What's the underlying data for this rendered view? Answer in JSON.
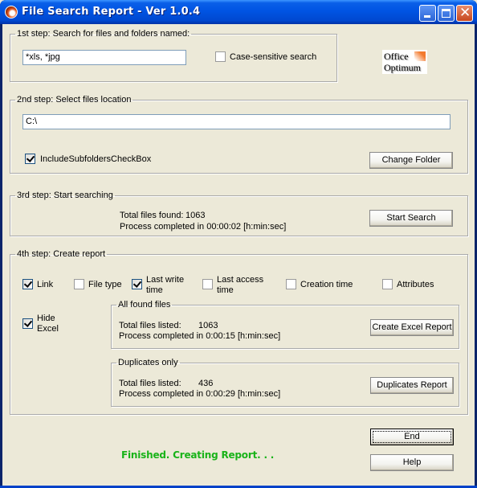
{
  "window": {
    "title": "File Search Report - Ver 1.0.4",
    "icons": {
      "app": "app-icon",
      "minimize": "minimize-icon",
      "maximize": "maximize-icon",
      "close": "close-icon"
    },
    "close_glyph": "✕"
  },
  "logo": {
    "line1": "Office",
    "line2": "Optimum",
    "accent_color": "#F37A2E"
  },
  "step1": {
    "legend": "1st step: Search for files and folders named:",
    "search_value": "*xls, *jpg",
    "case_sensitive_label": "Case-sensitive search",
    "case_sensitive_checked": false
  },
  "step2": {
    "legend": "2nd step: Select files location",
    "location_value": "C:\\",
    "include_subfolders_label": "IncludeSubfoldersCheckBox",
    "include_subfolders_checked": true,
    "change_folder_label": "Change Folder"
  },
  "step3": {
    "legend": "3rd step: Start searching",
    "total_found_label": "Total files found:",
    "total_found_value": "1063",
    "process_text": "Process completed in 00:00:02 [h:min:sec]",
    "start_search_label": "Start Search"
  },
  "step4": {
    "legend": "4th step: Create report",
    "options": [
      {
        "label": "Link",
        "checked": true
      },
      {
        "label": "File type",
        "checked": false
      },
      {
        "label_line1": "Last write",
        "label_line2": "time",
        "checked": true
      },
      {
        "label_line1": "Last access",
        "label_line2": "time",
        "checked": false
      },
      {
        "label": "Creation time",
        "checked": false
      },
      {
        "label": "Attributes",
        "checked": false
      }
    ],
    "hide_excel": {
      "label_line1": "Hide",
      "label_line2": "Excel",
      "checked": true
    },
    "all_found": {
      "legend": "All found files",
      "total_label": "Total files listed:",
      "total_value": "1063",
      "process_text": "Process completed in 0:00:15 [h:min:sec]",
      "button_label": "Create Excel Report"
    },
    "duplicates": {
      "legend": "Duplicates only",
      "total_label": "Total files listed:",
      "total_value": "436",
      "process_text": "Process completed in 0:00:29 [h:min:sec]",
      "button_label": "Duplicates Report"
    }
  },
  "footer": {
    "status_text": "Finished. Creating Report. . .",
    "status_color": "#19B319",
    "end_label": "End",
    "help_label": "Help"
  }
}
